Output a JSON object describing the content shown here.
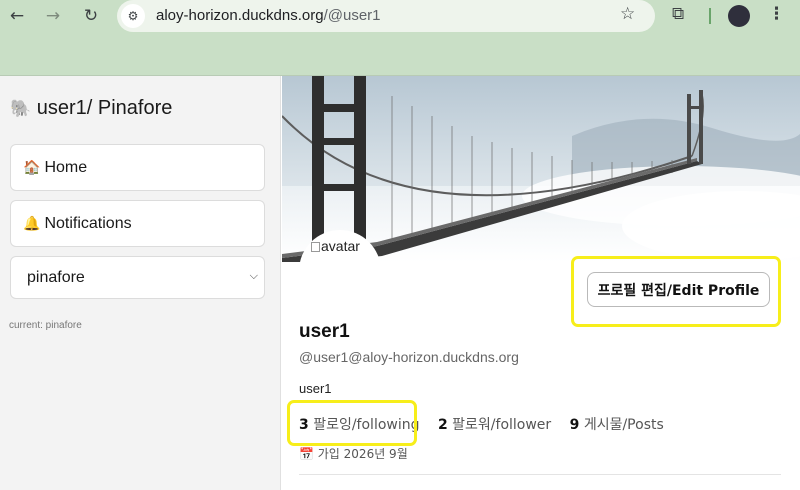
{
  "browser": {
    "back_icon": "←",
    "forward_icon": "→",
    "reload_icon": "↻",
    "site_settings_icon": "⚙",
    "url_host": "aloy-horizon.duckdns.org",
    "url_path": "/@user1",
    "bookmark_icon": "☆",
    "extensions_icon": "⧉",
    "menu_icon": "⋮"
  },
  "sidebar": {
    "title_emoji": "🐘",
    "title": " user1/ Pinafore",
    "items": [
      {
        "emoji": "🏠",
        "label": "Home"
      },
      {
        "emoji": "🔔",
        "label": "Notifications"
      }
    ],
    "select_value": "pinafore",
    "chevron": "⌵",
    "current_label": "current: pinafore"
  },
  "profile": {
    "avatar_alt": "avatar",
    "edit_button": "프로필 편집/Edit Profile",
    "display_name": "user1",
    "handle": "@user1@aloy-horizon.duckdns.org",
    "bio": "user1",
    "stats": [
      {
        "count": "3",
        "label": " 팔로잉/following"
      },
      {
        "count": "2",
        "label": " 팔로워/follower"
      },
      {
        "count": "9",
        "label": " 게시물/Posts"
      }
    ],
    "joined_emoji": "📅",
    "joined": " 가입 2026년 9월"
  },
  "colors": {
    "chrome_green": "#c9dfc6",
    "highlight_yellow": "#f7ee1a"
  }
}
